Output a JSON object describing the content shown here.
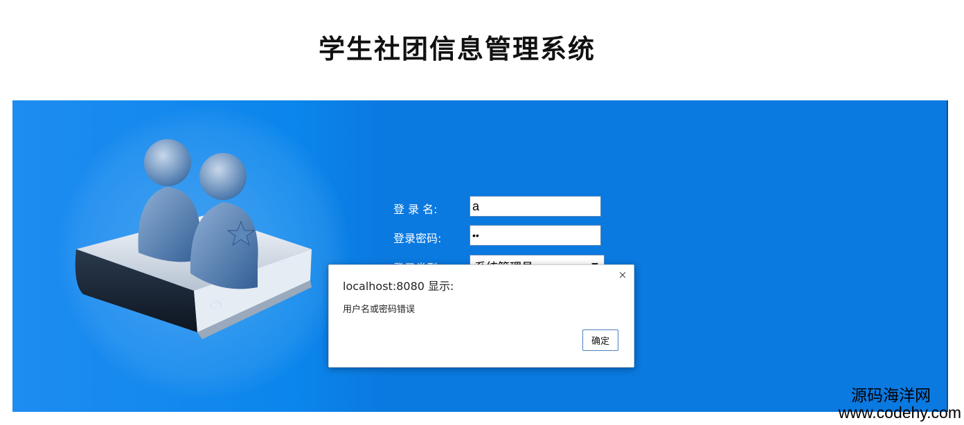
{
  "page": {
    "title": "学生社团信息管理系统"
  },
  "login_form": {
    "username_label": "登 录 名:",
    "username_value": "a",
    "password_label": "登录密码:",
    "password_value": "••",
    "type_label": "登录类型",
    "type_selected": "系统管理员"
  },
  "alert_dialog": {
    "title": "localhost:8080 显示:",
    "message": "用户名或密码错误",
    "ok_label": "确定",
    "close_glyph": "×"
  },
  "watermark": {
    "name": "源码海洋网",
    "url": "www.codehy.com"
  },
  "colors": {
    "panel_blue": "#0a79e0",
    "panel_light": "#1e8cf0"
  },
  "icons": [
    "users-illustration",
    "close-icon",
    "dropdown-arrow-icon"
  ]
}
